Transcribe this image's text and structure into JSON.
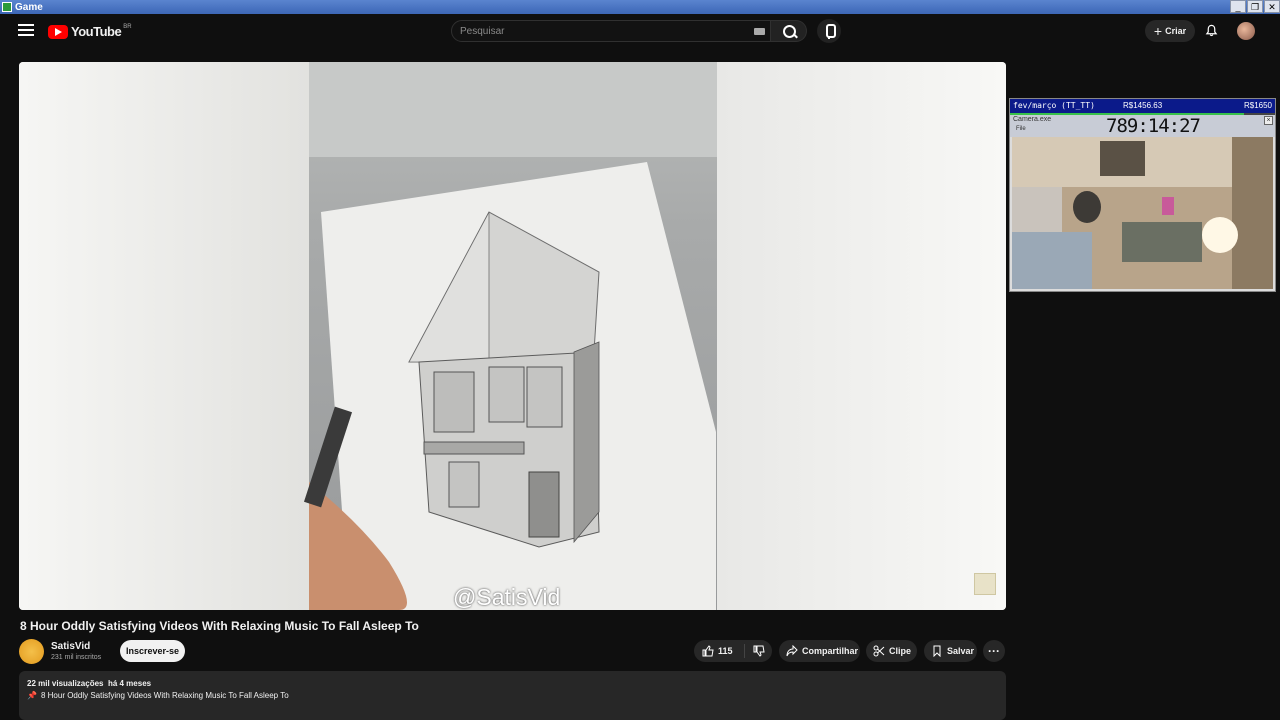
{
  "os_window": {
    "title": "Game",
    "controls": [
      "_",
      "❐",
      "✕"
    ]
  },
  "header": {
    "logo_text": "YouTube",
    "region": "BR",
    "search": {
      "placeholder": "Pesquisar",
      "value": ""
    },
    "create_label": "Criar"
  },
  "video": {
    "watermark": "@SatisVid",
    "title": "8 Hour Oddly Satisfying Videos With Relaxing Music To Fall Asleep To"
  },
  "channel": {
    "name": "SatisVid",
    "subscribers": "231 mil inscritos",
    "subscribe_label": "Inscrever-se"
  },
  "actions": {
    "likes": "115",
    "share_label": "Compartilhar",
    "clip_label": "Clipe",
    "save_label": "Salvar",
    "more_label": "···"
  },
  "description": {
    "views": "22 mil visualizações",
    "age": "há 4 meses",
    "pinned_icon": "📌",
    "first_line": "8 Hour Oddly Satisfying Videos With Relaxing Music To Fall Asleep To"
  },
  "overlay": {
    "period": "fev/março (TT_TT)",
    "amount": "R$1456.63",
    "goal": "R$1650",
    "progress_fraction": 0.883,
    "window_title": "Camera.exe",
    "file_menu": "File",
    "timer": "789:14:27"
  },
  "colors": {
    "background": "#0f0f0f",
    "brand_red": "#ff0000",
    "pill": "#272727",
    "overlay_header": "#0b1a8a"
  }
}
